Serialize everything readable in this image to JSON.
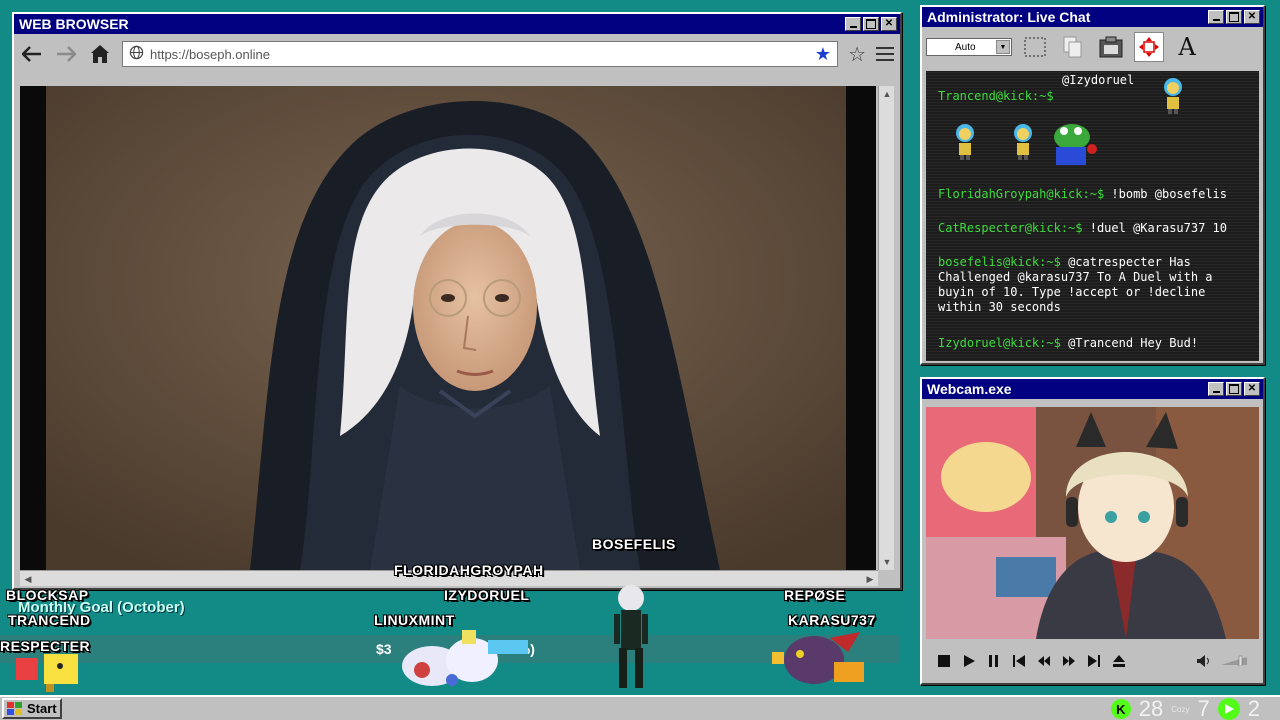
{
  "browser": {
    "title": "WEB BROWSER",
    "url": "https://boseph.online"
  },
  "chat": {
    "title": "Administrator: Live Chat",
    "font_select": "Auto",
    "messages": [
      {
        "user": "",
        "text": "@Izydoruel"
      },
      {
        "user": "Trancend@kick:~$",
        "text": ""
      },
      {
        "user": "FloridahGroypah@kick:~$",
        "text": "!bomb @bosefelis"
      },
      {
        "user": "CatRespecter@kick:~$",
        "text": "!duel @Karasu737 10"
      },
      {
        "user": "bosefelis@kick:~$",
        "text": "@catrespecter Has Challenged @karasu737 To A Duel with a buyin of 10. Type !accept or !decline within 30 seconds"
      },
      {
        "user": "Izydoruel@kick:~$",
        "text": "@Trancend Hey Bud!"
      }
    ]
  },
  "webcam": {
    "title": "Webcam.exe"
  },
  "stage": {
    "players": [
      "BLOCKSAP",
      "TRANCEND",
      "RESPECTER",
      "FLORIDAHGROYPAH",
      "IZYDORUEL",
      "LINUXMINT",
      "BOSEFELIS",
      "REPØSE",
      "KARASU737"
    ],
    "goal_label": "Monthly Goal (October)",
    "goal_amount": "$3",
    "goal_percent": "4%)"
  },
  "taskbar": {
    "start_label": "Start",
    "count_a": "28",
    "tray_small": "Cozy",
    "count_b": "7",
    "count_c": "2"
  },
  "colors": {
    "desktop": "#128a86",
    "titlebar": "#000080",
    "chat_user": "#3ddc3d",
    "kick_green": "#53fc18"
  }
}
